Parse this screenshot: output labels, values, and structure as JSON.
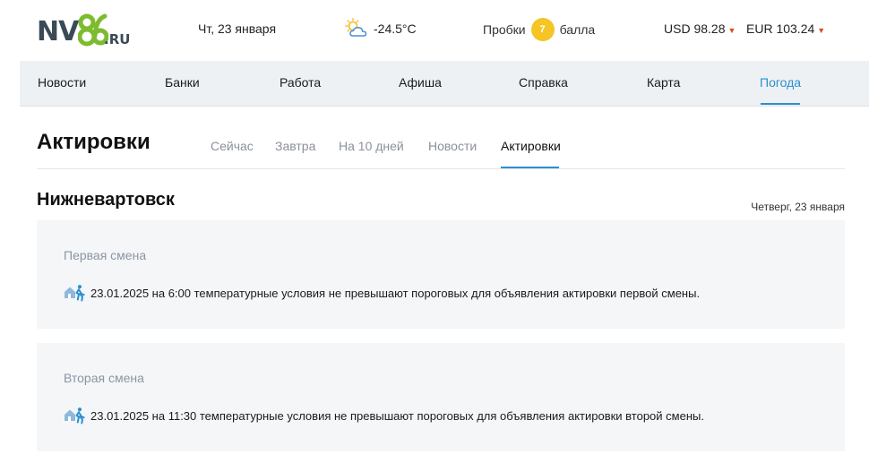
{
  "header": {
    "logo": {
      "part1": "NV",
      "part2": "86",
      "part3": ".RU"
    },
    "date": "Чт, 23 января",
    "weather": {
      "temperature": "-24.5°C",
      "icon": "partly-cloudy-icon"
    },
    "traffic": {
      "label": "Пробки",
      "score": "7",
      "unit": "балла"
    },
    "currency": {
      "usd": "USD 98.28",
      "eur": "EUR 103.24"
    }
  },
  "nav": {
    "items": [
      {
        "label": "Новости"
      },
      {
        "label": "Банки"
      },
      {
        "label": "Работа"
      },
      {
        "label": "Афиша"
      },
      {
        "label": "Справка"
      },
      {
        "label": "Карта"
      },
      {
        "label": "Погода"
      }
    ],
    "active_index": 6
  },
  "page": {
    "title": "Актировки",
    "tabs": [
      {
        "label": "Сейчас"
      },
      {
        "label": "Завтра"
      },
      {
        "label": "На 10 дней"
      },
      {
        "label": "Новости"
      },
      {
        "label": "Актировки"
      }
    ],
    "active_tab": 4,
    "city": "Нижневартовск",
    "date": "Четверг, 23 января"
  },
  "shifts": [
    {
      "title": "Первая смена",
      "text": "23.01.2025 на 6:00 температурные условия не превышают пороговых для объявления актировки первой смены."
    },
    {
      "title": "Вторая смена",
      "text": "23.01.2025 на 11:30 температурные условия не превышают пороговых для объявления актировки второй смены."
    }
  ],
  "colors": {
    "accent": "#2b8fcf",
    "logo_green": "#7dbb2f",
    "traffic_yellow": "#f5c425",
    "currency_caret": "#e04a1c"
  }
}
